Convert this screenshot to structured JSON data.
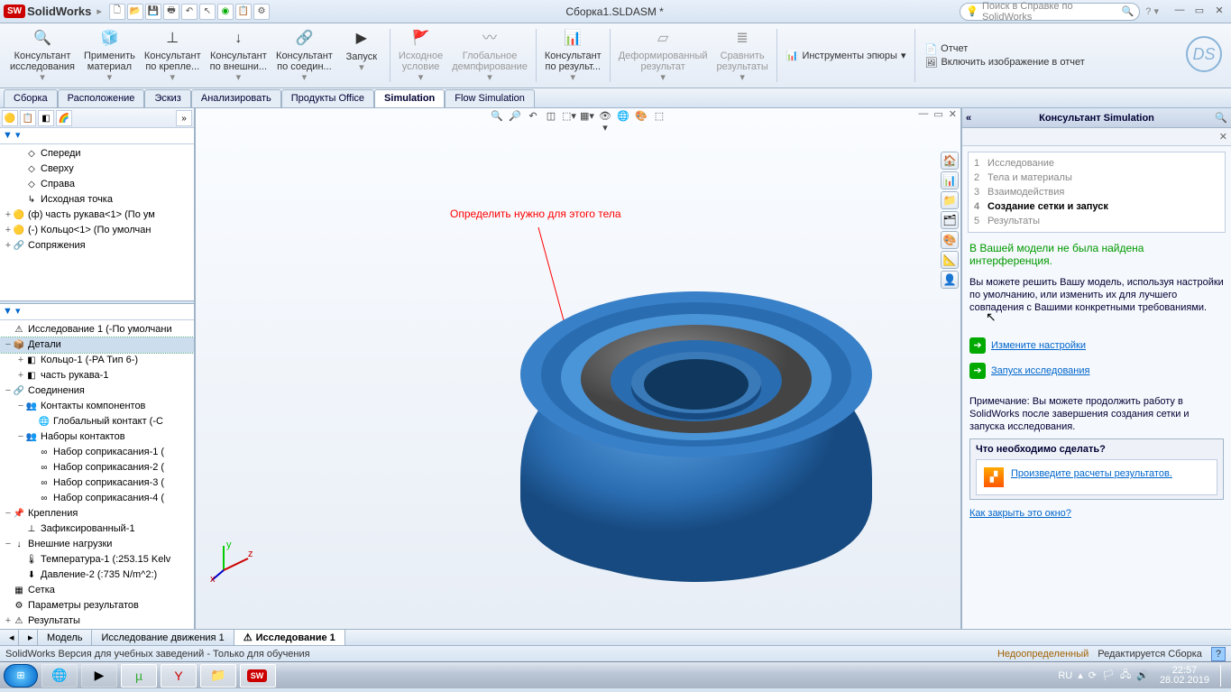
{
  "app": {
    "brand": "SolidWorks",
    "doc_title": "Сборка1.SLDASM *",
    "search_ph": "Поиск в Справке по SolidWorks"
  },
  "ribbon": {
    "btns": [
      {
        "l1": "Консультант",
        "l2": "исследования"
      },
      {
        "l1": "Применить",
        "l2": "материал"
      },
      {
        "l1": "Консультант",
        "l2": "по крепле..."
      },
      {
        "l1": "Консультант",
        "l2": "по внешни..."
      },
      {
        "l1": "Консультант",
        "l2": "по соедин..."
      },
      {
        "l1": "Запуск",
        "l2": ""
      },
      {
        "l1": "Исходное",
        "l2": "условие"
      },
      {
        "l1": "Глобальное",
        "l2": "демпфирование"
      },
      {
        "l1": "Консультант",
        "l2": "по результ..."
      },
      {
        "l1": "Деформированный",
        "l2": "результат"
      },
      {
        "l1": "Сравнить",
        "l2": "результаты"
      }
    ],
    "small": {
      "plot_tools": "Инструменты эпюры",
      "report": "Отчет",
      "include_img": "Включить изображение в отчет"
    }
  },
  "tabs": [
    "Сборка",
    "Расположение",
    "Эскиз",
    "Анализировать",
    "Продукты Office",
    "Simulation",
    "Flow Simulation"
  ],
  "tree_top": {
    "items": [
      {
        "ind": 1,
        "ico": "◇",
        "t": "Спереди"
      },
      {
        "ind": 1,
        "ico": "◇",
        "t": "Сверху"
      },
      {
        "ind": 1,
        "ico": "◇",
        "t": "Справа"
      },
      {
        "ind": 1,
        "ico": "↳",
        "t": "Исходная точка"
      },
      {
        "ind": 0,
        "exp": "+",
        "ico": "🟡",
        "t": "(ф) часть рукава<1> (По ум"
      },
      {
        "ind": 0,
        "exp": "+",
        "ico": "🟡",
        "t": "(-) Кольцо<1> (По умолчан"
      },
      {
        "ind": 0,
        "exp": "+",
        "ico": "🔗",
        "t": "Сопряжения"
      }
    ]
  },
  "tree_btm": {
    "items": [
      {
        "ind": 0,
        "exp": "",
        "ico": "⚠",
        "t": "Исследование 1 (-По умолчани"
      },
      {
        "ind": 0,
        "exp": "−",
        "ico": "📦",
        "t": "Детали",
        "sel": true
      },
      {
        "ind": 1,
        "exp": "+",
        "ico": "◧",
        "t": "Кольцо-1 (-PA Тип 6-)"
      },
      {
        "ind": 1,
        "exp": "+",
        "ico": "◧",
        "t": "часть рукава-1"
      },
      {
        "ind": 0,
        "exp": "−",
        "ico": "🔗",
        "t": "Соединения"
      },
      {
        "ind": 1,
        "exp": "−",
        "ico": "👥",
        "t": "Контакты компонентов"
      },
      {
        "ind": 2,
        "exp": "",
        "ico": "🌐",
        "t": "Глобальный контакт (-С"
      },
      {
        "ind": 1,
        "exp": "−",
        "ico": "👥",
        "t": "Наборы контактов"
      },
      {
        "ind": 2,
        "exp": "",
        "ico": "∞",
        "t": "Набор соприкасания-1 ("
      },
      {
        "ind": 2,
        "exp": "",
        "ico": "∞",
        "t": "Набор соприкасания-2 ("
      },
      {
        "ind": 2,
        "exp": "",
        "ico": "∞",
        "t": "Набор соприкасания-3 ("
      },
      {
        "ind": 2,
        "exp": "",
        "ico": "∞",
        "t": "Набор соприкасания-4 ("
      },
      {
        "ind": 0,
        "exp": "−",
        "ico": "📌",
        "t": "Крепления"
      },
      {
        "ind": 1,
        "exp": "",
        "ico": "⊥",
        "t": "Зафиксированный-1"
      },
      {
        "ind": 0,
        "exp": "−",
        "ico": "↓",
        "t": "Внешние нагрузки"
      },
      {
        "ind": 1,
        "exp": "",
        "ico": "🌡",
        "t": "Температура-1 (:253.15 Kelv"
      },
      {
        "ind": 1,
        "exp": "",
        "ico": "⬇",
        "t": "Давление-2 (:735 N/m^2:)"
      },
      {
        "ind": 0,
        "exp": "",
        "ico": "▦",
        "t": "Сетка"
      },
      {
        "ind": 0,
        "exp": "",
        "ico": "⚙",
        "t": "Параметры результатов"
      },
      {
        "ind": 0,
        "exp": "+",
        "ico": "⚠",
        "t": "Результаты"
      }
    ]
  },
  "annotation": "Определить нужно для этого тела",
  "side": {
    "title": "Консультант Simulation",
    "steps": [
      {
        "n": "1",
        "t": "Исследование"
      },
      {
        "n": "2",
        "t": "Тела и материалы"
      },
      {
        "n": "3",
        "t": "Взаимодействия"
      },
      {
        "n": "4",
        "t": "Создание сетки и запуск",
        "cur": true
      },
      {
        "n": "5",
        "t": "Результаты"
      }
    ],
    "ok_msg": "В Вашей модели не была найдена интерференция.",
    "info": "Вы можете решить Вашу модель, используя настройки по умолчанию, или изменить их для лучшего совпадения с Вашими конкретными требованиями.",
    "act1": "Измените настройки",
    "act2": "Запуск исследования",
    "note": "Примечание: Вы можете продолжить работу в SolidWorks после завершения создания сетки и запуска исследования.",
    "box_hdr": "Что необходимо сделать?",
    "box_link": "Произведите расчеты результатов.",
    "close": "Как закрыть это окно?"
  },
  "bot_tabs": [
    {
      "t": "Модель"
    },
    {
      "t": "Исследование движения 1"
    },
    {
      "t": "Исследование 1",
      "active": true
    }
  ],
  "status": {
    "left": "SolidWorks Версия для учебных заведений - Только для обучения",
    "r1": "Недоопределенный",
    "r2": "Редактируется Сборка"
  },
  "tray": {
    "lang": "RU",
    "time": "22:57",
    "date": "28.02.2019"
  }
}
